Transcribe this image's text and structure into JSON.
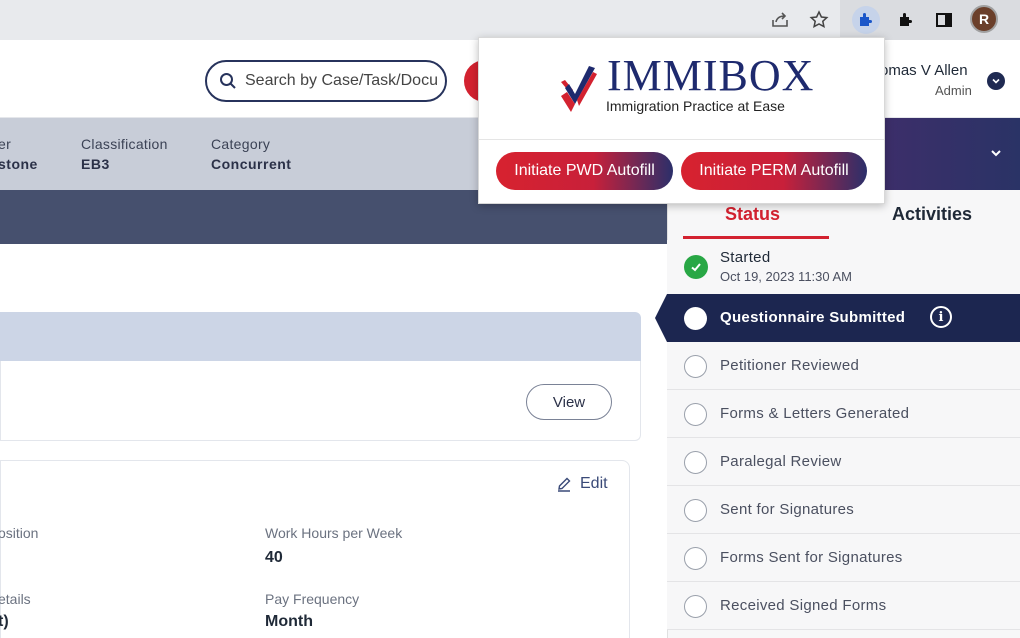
{
  "app": {
    "search": {
      "placeholder": "Search by Case/Task/Docu"
    },
    "user": {
      "name": "omas V Allen",
      "role": "Admin"
    }
  },
  "case_info": [
    {
      "label": "er",
      "value": "stone"
    },
    {
      "label": "Classification",
      "value": "EB3"
    },
    {
      "label": "Category",
      "value": "Concurrent"
    }
  ],
  "details": {
    "view_label": "View",
    "edit_label": "Edit",
    "fields": [
      {
        "label": "osition",
        "value": ""
      },
      {
        "label": "Work Hours per Week",
        "value": "40"
      },
      {
        "label": "etails",
        "value": "t)"
      },
      {
        "label": "Pay Frequency",
        "value": "Month"
      }
    ]
  },
  "status_panel": {
    "tabs": [
      "Status",
      "Activities"
    ],
    "active_tab": "Status",
    "items": [
      {
        "label": "Started",
        "date": "Oct 19, 2023 11:30 AM",
        "state": "done"
      },
      {
        "label": "Questionnaire Submitted",
        "state": "current"
      },
      {
        "label": "Petitioner Reviewed",
        "state": "pending"
      },
      {
        "label": "Forms & Letters Generated",
        "state": "pending"
      },
      {
        "label": "Paralegal Review",
        "state": "pending"
      },
      {
        "label": "Sent for Signatures",
        "state": "pending"
      },
      {
        "label": "Forms Sent for Signatures",
        "state": "pending"
      },
      {
        "label": "Received Signed Forms",
        "state": "pending"
      }
    ]
  },
  "extension_popup": {
    "brand": "IMMIBOX",
    "tagline": "Immigration Practice at Ease",
    "buttons": [
      "Initiate PWD Autofill",
      "Initiate PERM Autofill"
    ]
  },
  "browser": {
    "profile_initial": "R",
    "icons": [
      "share-icon",
      "star-icon",
      "immibox-extension-icon",
      "extensions-puzzle-icon",
      "side-panel-icon"
    ]
  },
  "colors": {
    "brand_navy": "#1c2650",
    "brand_red": "#d32230",
    "success_green": "#28a745",
    "info_band": "#c8cdd8"
  }
}
